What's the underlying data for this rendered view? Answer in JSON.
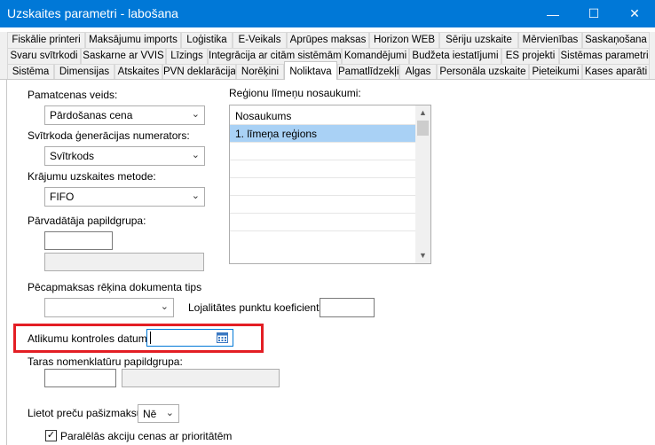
{
  "window": {
    "title": "Uzskaites parametri - labošana",
    "minimize": "—",
    "maximize": "☐",
    "close": "✕",
    "accent": "#0078d7"
  },
  "tabs": {
    "row1": [
      "Fiskālie printeri",
      "Maksājumu imports",
      "Loģistika",
      "E-Veikals",
      "Aprūpes maksas",
      "Horizon WEB",
      "Sēriju uzskaite",
      "Mērvienības",
      "Saskaņošana"
    ],
    "row2": [
      "Svaru svītrkodi",
      "Saskarne ar VVIS",
      "Līzings",
      "Integrācija ar citām sistēmām",
      "Komandējumi",
      "Budžeta iestatījumi",
      "ES projekti",
      "Sistēmas parametri"
    ],
    "row3": [
      "Sistēma",
      "Dimensijas",
      "Atskaites",
      "PVN deklarācija",
      "Norēķini",
      "Noliktava",
      "Pamatlīdzekļi",
      "Algas",
      "Personāla uzskaite",
      "Pieteikumi",
      "Kases aparāti"
    ],
    "active": "Noliktava"
  },
  "form": {
    "base_price_type_label": "Pamatcenas veids:",
    "base_price_type_value": "Pārdošanas cena",
    "barcode_generator_label": "Svītrkoda ģenerācijas numerators:",
    "barcode_generator_value": "Svītrkods",
    "inventory_method_label": "Krājumu uzskaites metode:",
    "inventory_method_value": "FIFO",
    "seller_subgroup_label": "Pārvadātāja papildgrupa:",
    "postpaid_doc_type_label": "Pēcapmaksas rēķina dokumenta tips",
    "loyalty_coefficient_label": "Lojalitātes punktu koeficients:",
    "balance_control_date_label": "Atlikumu kontroles datums:",
    "goods_nomenclature_subgroup_label": "Taras nomenklatūru papildgrupa:",
    "use_goods_attribute_label": "Lietot preču pašizmaksu:",
    "use_goods_attribute_value": "Nē",
    "parallel_prices_label": "Paralēlās akciju cenas ar prioritātēm",
    "parallel_prices_checked": "✓"
  },
  "regions": {
    "label": "Reģionu līmeņu nosaukumi:",
    "header": "Nosaukums",
    "rows": [
      "1. līmeņa reģions"
    ]
  },
  "icons": {
    "dropdown": "⌄",
    "scroll_up": "▲",
    "scroll_down": "▼",
    "calendar": "calendar-icon"
  },
  "highlight_color": "#e31e24"
}
